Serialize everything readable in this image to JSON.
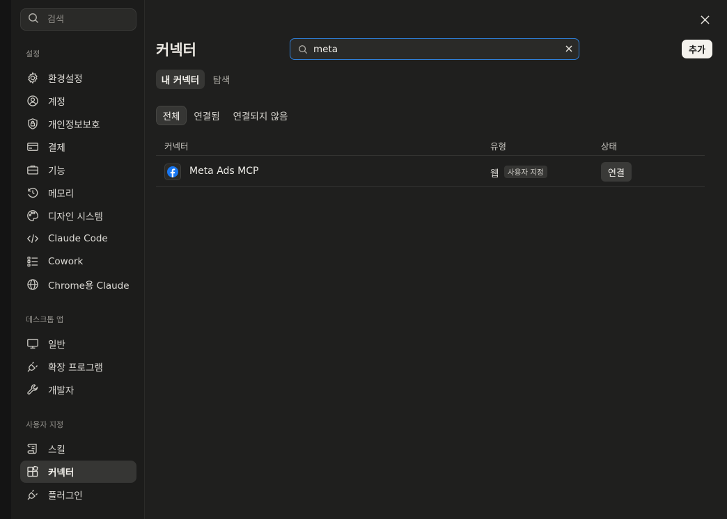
{
  "sidebar": {
    "search_placeholder": "검색",
    "sections": {
      "settings": "설정",
      "desktop": "데스크톱 앱",
      "custom": "사용자 지정"
    },
    "items": [
      {
        "label": "환경설정",
        "icon": "gear-icon"
      },
      {
        "label": "계정",
        "icon": "user-icon"
      },
      {
        "label": "개인정보보호",
        "icon": "lock-shield-icon"
      },
      {
        "label": "결제",
        "icon": "credit-card-icon"
      },
      {
        "label": "기능",
        "icon": "briefcase-icon"
      },
      {
        "label": "메모리",
        "icon": "history-icon"
      },
      {
        "label": "디자인 시스템",
        "icon": "palette-icon"
      },
      {
        "label": "Claude Code",
        "icon": "code-icon"
      },
      {
        "label": "Cowork",
        "icon": "checklist-icon"
      },
      {
        "label": "Chrome용 Claude",
        "icon": "globe-icon"
      },
      {
        "label": "일반",
        "icon": "monitor-icon"
      },
      {
        "label": "확장 프로그램",
        "icon": "plug-icon"
      },
      {
        "label": "개발자",
        "icon": "wrench-icon"
      },
      {
        "label": "스킬",
        "icon": "scroll-icon"
      },
      {
        "label": "커넥터",
        "icon": "blocks-icon"
      },
      {
        "label": "플러그인",
        "icon": "plug-icon"
      }
    ],
    "active_item": "커넥터"
  },
  "main": {
    "title": "커넥터",
    "search_value": "meta",
    "add_label": "추가",
    "tabs": [
      {
        "label": "내 커넥터",
        "active": true
      },
      {
        "label": "탐색",
        "active": false
      }
    ],
    "filters": [
      {
        "label": "전체",
        "active": true
      },
      {
        "label": "연결됨",
        "active": false
      },
      {
        "label": "연결되지 않음",
        "active": false
      }
    ],
    "table": {
      "headers": [
        "커넥터",
        "유형",
        "상태"
      ],
      "rows": [
        {
          "name": "Meta Ads MCP",
          "icon": "facebook-icon",
          "type": "웹",
          "badge": "사용자 지정",
          "action": "연결"
        }
      ]
    }
  },
  "colors": {
    "accent": "#2f7fd8",
    "background": "#1f1f1e",
    "facebook": "#1877f2"
  }
}
